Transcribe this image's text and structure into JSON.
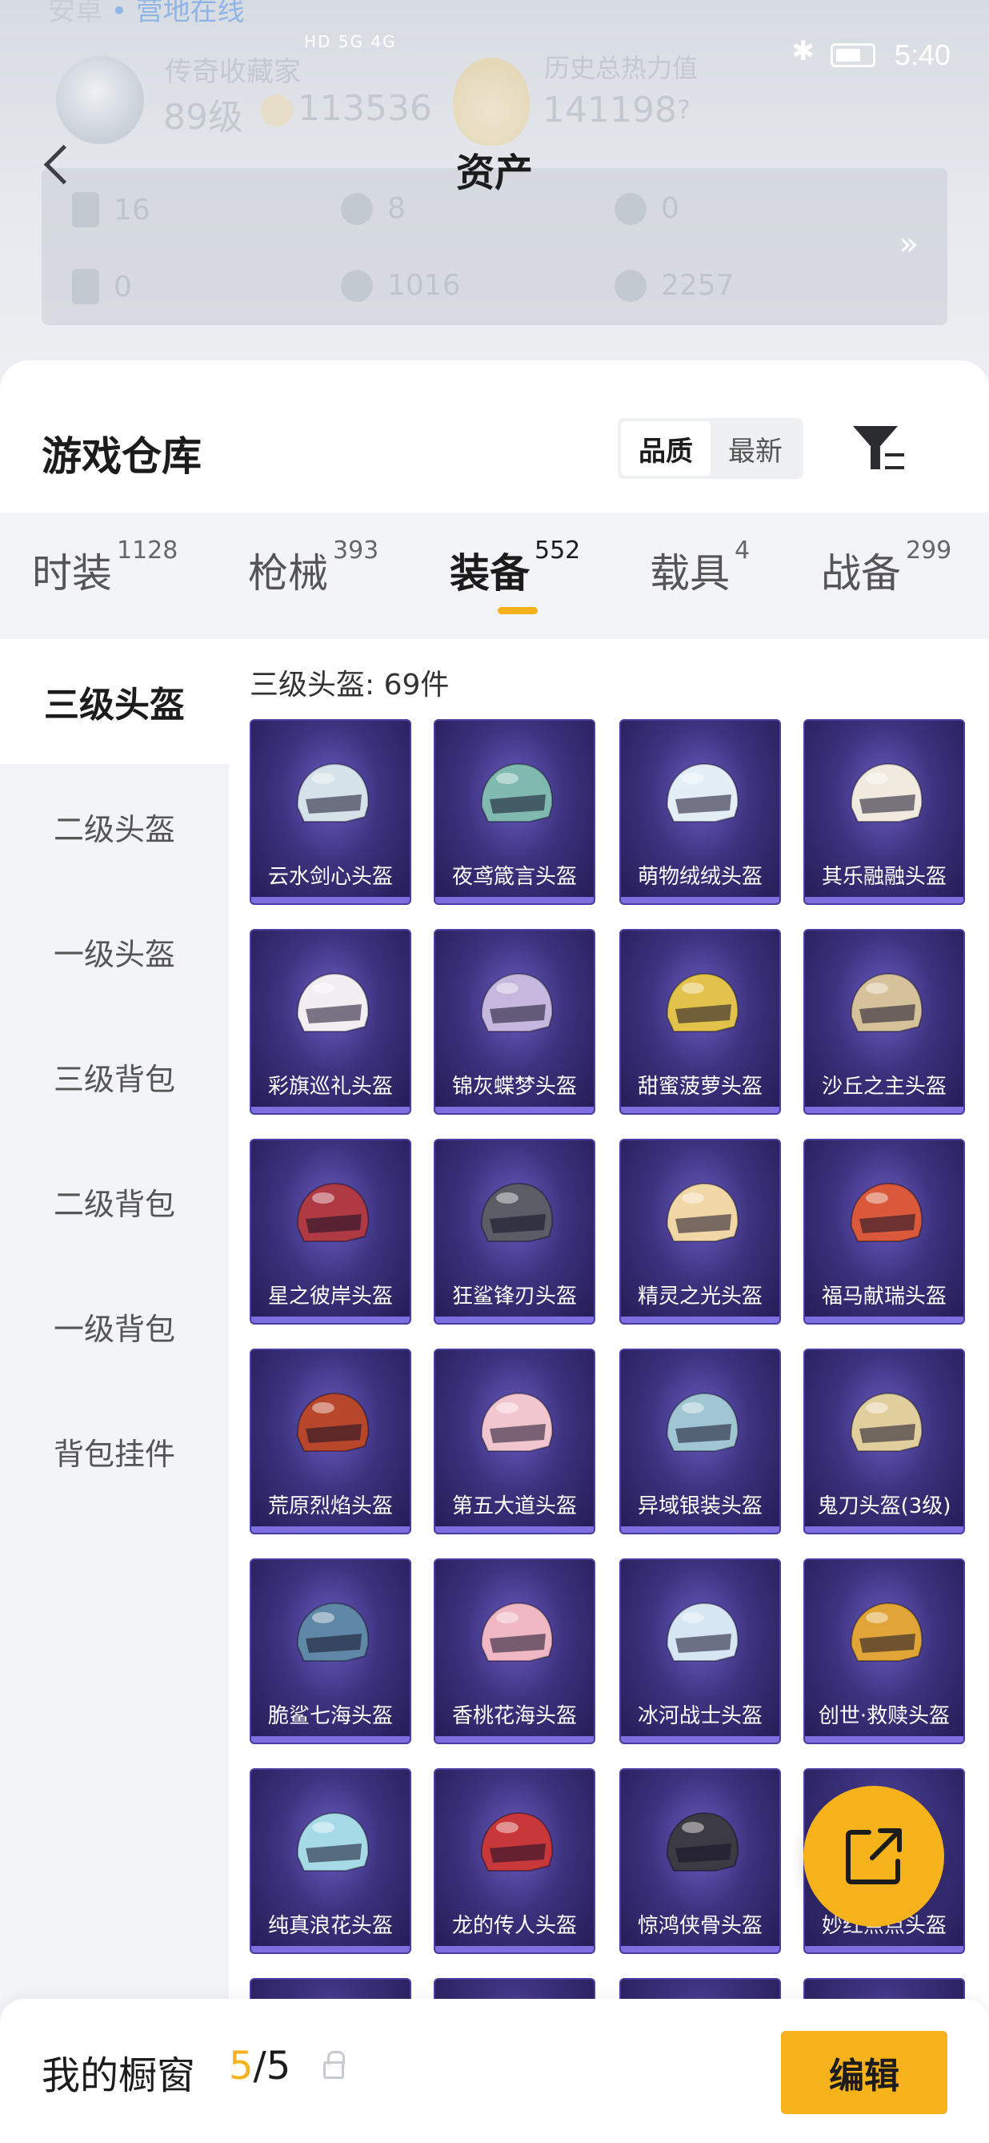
{
  "status_bar": {
    "time": "5:40",
    "network": "HD 5G 4G"
  },
  "profile": {
    "online_prefix": "安卓",
    "online_status": "营地在线",
    "rank_name": "传奇收藏家",
    "level": "89级",
    "coins": "113536",
    "heat_label": "历史总热力值",
    "heat_value": "141198",
    "heat_help": "?"
  },
  "header": {
    "title": "资产",
    "back_label": ""
  },
  "assets": {
    "row1": [
      "16",
      "8",
      "0"
    ],
    "row2": [
      "0",
      "1016",
      "2257"
    ],
    "more": "»"
  },
  "warehouse": {
    "title": "游戏仓库",
    "sort_options": [
      "品质",
      "最新"
    ],
    "sort_active": 0
  },
  "tabs": [
    {
      "label": "时装",
      "count": "1128"
    },
    {
      "label": "枪械",
      "count": "393"
    },
    {
      "label": "装备",
      "count": "552"
    },
    {
      "label": "载具",
      "count": "4"
    },
    {
      "label": "战备",
      "count": "299"
    }
  ],
  "active_tab": 2,
  "sidebar": [
    "三级头盔",
    "二级头盔",
    "一级头盔",
    "三级背包",
    "二级背包",
    "一级背包",
    "背包挂件"
  ],
  "active_sidebar": 0,
  "grid": {
    "heading": "三级头盔: 69件",
    "items": [
      {
        "name": "云水剑心头盔",
        "color": "#d6e2ea"
      },
      {
        "name": "夜鸢箴言头盔",
        "color": "#7fb9b0"
      },
      {
        "name": "萌物绒绒头盔",
        "color": "#e4eef6"
      },
      {
        "name": "其乐融融头盔",
        "color": "#f1eadf"
      },
      {
        "name": "彩旗巡礼头盔",
        "color": "#f2eef2"
      },
      {
        "name": "锦灰蝶梦头盔",
        "color": "#c6b7de"
      },
      {
        "name": "甜蜜菠萝头盔",
        "color": "#e2c24a"
      },
      {
        "name": "沙丘之主头盔",
        "color": "#d6c29a"
      },
      {
        "name": "星之彼岸头盔",
        "color": "#b03a44"
      },
      {
        "name": "狂鲨锋刃头盔",
        "color": "#5a5d66"
      },
      {
        "name": "精灵之光头盔",
        "color": "#f1d6a6"
      },
      {
        "name": "福马献瑞头盔",
        "color": "#d9593a"
      },
      {
        "name": "荒原烈焰头盔",
        "color": "#b8462a"
      },
      {
        "name": "第五大道头盔",
        "color": "#f2c6cf"
      },
      {
        "name": "异域银装头盔",
        "color": "#9fc6d2"
      },
      {
        "name": "鬼刀头盔(3级)",
        "color": "#e2cf9e"
      },
      {
        "name": "脆鲨七海头盔",
        "color": "#5f87a6"
      },
      {
        "name": "香桃花海头盔",
        "color": "#f0b7c4"
      },
      {
        "name": "冰河战士头盔",
        "color": "#d6e6f2"
      },
      {
        "name": "创世·救赎头盔",
        "color": "#e0a536"
      },
      {
        "name": "纯真浪花头盔",
        "color": "#a6dae6"
      },
      {
        "name": "龙的传人头盔",
        "color": "#c8373a"
      },
      {
        "name": "惊鸿侠骨头盔",
        "color": "#3c3a42"
      },
      {
        "name": "妙红点点头盔",
        "color": "#e05a6a"
      }
    ]
  },
  "showcase": {
    "label": "我的橱窗",
    "current": "5",
    "total": "/5"
  },
  "edit_button": "编辑",
  "colors": {
    "accent": "#f6b21a",
    "card_bg": "#3d327e"
  }
}
